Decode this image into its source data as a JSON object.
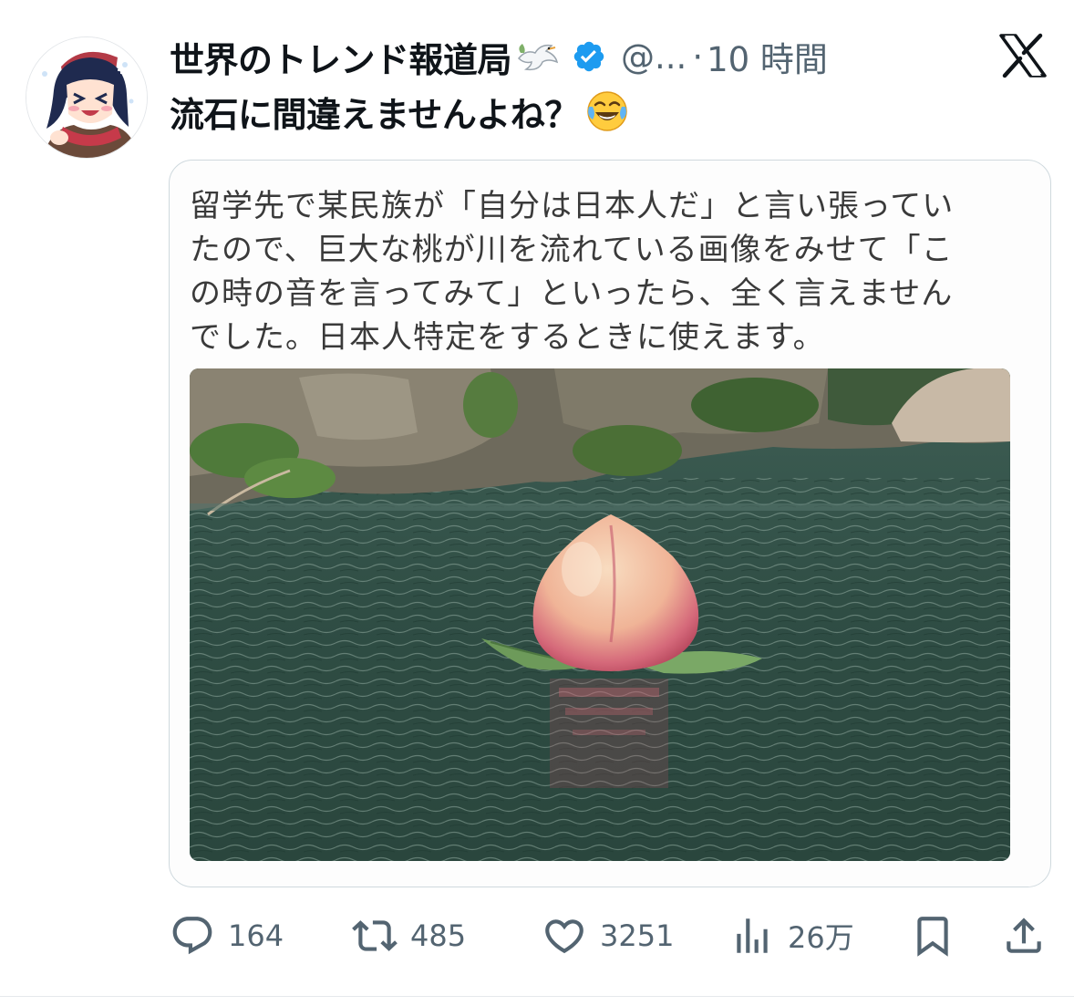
{
  "author": {
    "display_name": "世界のトレンド報道局",
    "handle": "@...",
    "separator": "·",
    "time": "10 時間",
    "avatar_icon": "anime-avatar-icon",
    "badge_icon": "verified-badge-icon",
    "name_icon": "dove-icon"
  },
  "tweet": {
    "text": "流石に間違えませんよね？",
    "emoji": "face-with-tears-of-joy-icon"
  },
  "media": {
    "caption_lines": [
      "留学先で某民族が「自分は日本人だ」と言い張ってい",
      "たので、巨大な桃が川を流れている画像をみせて「こ",
      "の時の音を言ってみて」といったら、全く言えません",
      "でした。日本人特定をするときに使えます。"
    ],
    "photo_subject": "peach-floating-river-photo"
  },
  "actions": {
    "reply": {
      "count": "164",
      "icon": "reply-icon"
    },
    "repost": {
      "count": "485",
      "icon": "repost-icon"
    },
    "like": {
      "count": "3251",
      "icon": "heart-icon"
    },
    "views": {
      "count": "26万",
      "icon": "views-chart-icon"
    },
    "bookmark": {
      "icon": "bookmark-icon"
    },
    "share": {
      "icon": "share-icon"
    }
  },
  "colors": {
    "text": "#0f1419",
    "secondary": "#536471",
    "verified": "#1d9bf0",
    "border": "#cfd9de"
  }
}
